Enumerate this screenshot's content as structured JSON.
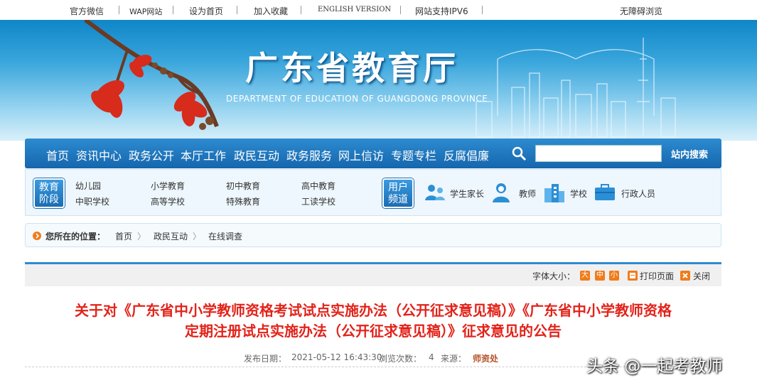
{
  "top_links": [
    "官方微信",
    "WAP网站",
    "设为首页",
    "加入收藏",
    "ENGLISH VERSION",
    "网站支持IPV6"
  ],
  "accessibility": "无障碍浏览",
  "banner": {
    "title": "广东省教育厅",
    "subtitle": "DEPARTMENT OF EDUCATION OF GUANGDONG PROVINCE"
  },
  "nav": {
    "items": [
      "首页",
      "资讯中心",
      "政务公开",
      "本厅工作",
      "政民互动",
      "政务服务",
      "网上信访",
      "专题专栏",
      "反腐倡廉"
    ],
    "search_label": "站内搜索",
    "search_value": ""
  },
  "channels": {
    "stage_badge": [
      "教育",
      "阶段"
    ],
    "stage_links": [
      "幼儿园",
      "小学教育",
      "初中教育",
      "高中教育",
      "中职学校",
      "高等学校",
      "特殊教育",
      "工读学校"
    ],
    "user_badge": [
      "用户",
      "频道"
    ],
    "user_roles": [
      "学生家长",
      "教师",
      "学校",
      "行政人员"
    ]
  },
  "breadcrumb": {
    "label": "您所在的位置：",
    "items": [
      "首页",
      "政民互动",
      "在线调查"
    ],
    "separator": "〉"
  },
  "tools": {
    "font_size_label": "字体大小：",
    "sizes": [
      "大",
      "中",
      "小"
    ],
    "print": "打印页面",
    "close": "关闭"
  },
  "article": {
    "title_line1": "关于对《广东省中小学教师资格考试试点实施办法（公开征求意见稿）》《广东省中小学教师资格",
    "title_line2": "定期注册试点实施办法（公开征求意见稿）》征求意见的公告",
    "date_label": "发布日期：",
    "date": "2021-05-12 16:43:30",
    "views_label": "浏览次数：",
    "views": "4",
    "source_label": "来源：",
    "source": "师资处"
  },
  "watermark": "头条 @一起考教师",
  "colors": {
    "nav_blue": "#1566ad",
    "title_red": "#e2231a",
    "accent_orange": "#f07c1a"
  }
}
